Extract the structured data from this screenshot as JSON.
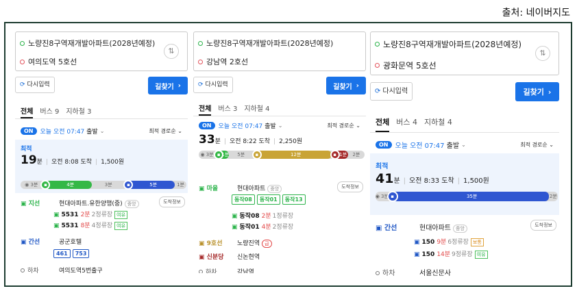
{
  "source_label": "출처: 네이버지도",
  "panels": [
    {
      "origin": "노량진8구역재개발아파트(2028년예정)",
      "destination": "여의도역 5호선",
      "reset_label": "다시입력",
      "search_label": "길찾기",
      "tabs": [
        "전체",
        "버스 9",
        "지하철 3"
      ],
      "depart_on": "ON",
      "depart_time": "오늘 오전 07:47",
      "depart_suffix": "출발",
      "sort_label": "최적 경로순",
      "badge": "최적",
      "duration": "19",
      "duration_unit": "분",
      "arrival": "오전 8:08 도착",
      "fare": "1,500원",
      "bar": [
        {
          "kind": "walk",
          "label": "3분",
          "frac": 0.13
        },
        {
          "kind": "green",
          "label": "4분",
          "frac": 0.3
        },
        {
          "kind": "walk",
          "label": "3분",
          "frac": 0.2
        },
        {
          "kind": "blue",
          "label": "5분",
          "frac": 0.3
        },
        {
          "kind": "walk",
          "label": "1분",
          "frac": 0.07
        }
      ],
      "legs": {
        "leg1_type": "지선",
        "leg1_stop": "현대아파트.유한양행(중)",
        "leg1_tag": "중앙",
        "arrive_info": "도착정보",
        "bus1_num": "5531",
        "bus1_min": "2분",
        "bus1_stops": "2정류장",
        "bus1_crowd": "여유",
        "bus2_num": "5531",
        "bus2_min": "8분",
        "bus2_stops": "4정류장",
        "bus2_crowd": "여유",
        "leg2_type": "간선",
        "leg2_stop": "공군호텔",
        "chips": [
          "461",
          "753"
        ],
        "leg3_type": "하차",
        "leg3_stop": "여의도역5번출구"
      }
    },
    {
      "origin": "노량진8구역재개발아파트(2028년예정)",
      "destination": "강남역 2호선",
      "reset_label": "다시입력",
      "search_label": "길찾기",
      "tabs": [
        "전체",
        "버스 3",
        "지하철 4"
      ],
      "depart_on": "ON",
      "depart_time": "오늘 오전 07:47",
      "depart_suffix": "출발",
      "sort_label": "최적 경로순",
      "duration": "33",
      "duration_unit": "분",
      "arrival": "오전 8:22 도착",
      "fare": "2,250원",
      "bar": [
        {
          "kind": "walk",
          "label": "3분",
          "frac": 0.1
        },
        {
          "kind": "green",
          "label": "1분",
          "frac": 0.08
        },
        {
          "kind": "walk",
          "label": "5분",
          "frac": 0.15
        },
        {
          "kind": "gold",
          "label": "12분",
          "frac": 0.47
        },
        {
          "kind": "maroon",
          "label": "1분",
          "frac": 0.1
        },
        {
          "kind": "walk",
          "label": "2분",
          "frac": 0.1
        }
      ],
      "legs": {
        "leg1_type": "마을",
        "leg1_stop": "현대아파트",
        "leg1_tag": "중앙",
        "arrive_info": "도착정보",
        "chips": [
          "동작08",
          "동작01",
          "동작13"
        ],
        "bus1_num": "동작08",
        "bus1_min": "2분",
        "bus1_stops": "1정류장",
        "bus2_num": "동작01",
        "bus2_min": "4분",
        "bus2_stops": "2정류장",
        "leg2_type": "9호선",
        "leg2_stop": "노량진역",
        "leg2_tag": "급",
        "leg3_type": "신분당",
        "leg3_stop": "신논현역",
        "leg4_type": "하차",
        "leg4_stop": "강남역"
      }
    },
    {
      "origin": "노량진8구역재개발아파트(2028년예정)",
      "destination": "광화문역 5호선",
      "reset_label": "다시입력",
      "search_label": "길찾기",
      "tabs": [
        "전체",
        "버스 4",
        "지하철 4"
      ],
      "depart_on": "ON",
      "depart_time": "오늘 오전 07:47",
      "depart_suffix": "출발",
      "sort_label": "최적 경로순",
      "badge": "최적",
      "duration": "41",
      "duration_unit": "분",
      "arrival": "오전 8:33 도착",
      "fare": "1,500원",
      "bar": [
        {
          "kind": "walk",
          "label": "3분",
          "frac": 0.07
        },
        {
          "kind": "blue",
          "label": "35분",
          "frac": 0.88
        },
        {
          "kind": "walk",
          "label": "2분",
          "frac": 0.05
        }
      ],
      "legs": {
        "leg1_type": "간선",
        "leg1_stop": "현대아파트",
        "leg1_tag": "중앙",
        "arrive_info": "도착정보",
        "bus1_num": "150",
        "bus1_min": "9분",
        "bus1_stops": "6정류장",
        "bus1_crowd": "보통",
        "bus2_num": "150",
        "bus2_min": "14분",
        "bus2_stops": "9정류장",
        "bus2_crowd": "여유",
        "leg3_type": "하차",
        "leg3_stop": "서울신문사"
      }
    }
  ],
  "colors": {
    "accent": "#1a73e8",
    "bus_green": "#2bb34a",
    "bus_blue": "#1d55c4",
    "line9": "#c9a436",
    "sinbundang": "#a52a2a",
    "frame": "#1d3c30"
  },
  "icons": [
    "swap-icon",
    "refresh-icon",
    "chevron-right-icon",
    "bus-icon",
    "subway-icon",
    "walk-icon"
  ]
}
